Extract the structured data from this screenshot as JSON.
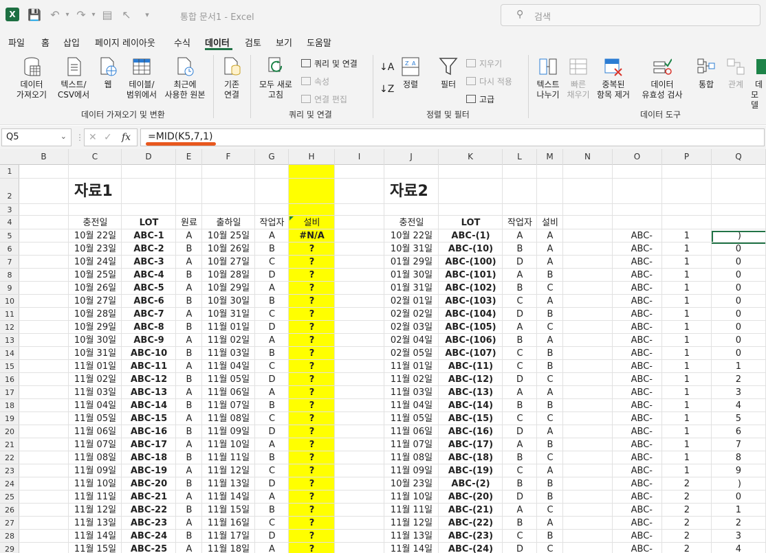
{
  "title_bar": {
    "doc_title": "통합 문서1  -  Excel",
    "search_placeholder": "검색"
  },
  "tabs": [
    "파일",
    "홈",
    "삽입",
    "페이지 레이아웃",
    "수식",
    "데이터",
    "검토",
    "보기",
    "도움말"
  ],
  "active_tab": "데이터",
  "ribbon": {
    "get_data": "데이터\n가져오기",
    "text_csv": "텍스트/\nCSV에서",
    "web": "웹",
    "table_range": "테이블/\n범위에서",
    "recent_sources": "최근에\n사용한 원본",
    "existing_connections": "기존\n연결",
    "group1_label": "데이터 가져오기 및 변환",
    "refresh_all": "모두 새로\n고침",
    "queries_connections": "쿼리 및 연결",
    "properties": "속성",
    "edit_links": "연결 편집",
    "group2_label": "쿼리 및 연결",
    "sort": "정렬",
    "filter": "필터",
    "clear": "지우기",
    "reapply": "다시 적용",
    "advanced": "고급",
    "group3_label": "정렬 및 필터",
    "text_to_columns": "텍스트\n나누기",
    "flash_fill": "빠른\n채우기",
    "remove_duplicates": "중복된\n항목 제거",
    "data_validation": "데이터\n유효성 검사",
    "consolidate": "통합",
    "relationships": "관계",
    "data_model": "데\n모델",
    "group4_label": "데이터 도구"
  },
  "formula_bar": {
    "name_box": "Q5",
    "formula": "=MID(K5,7,1)",
    "fx_label": "fx"
  },
  "columns": [
    "B",
    "C",
    "D",
    "E",
    "F",
    "G",
    "H",
    "I",
    "J",
    "K",
    "L",
    "M",
    "N",
    "O",
    "P",
    "Q"
  ],
  "rows_visible": [
    "1",
    "2",
    "3",
    "4",
    "5",
    "6",
    "7",
    "8",
    "9",
    "10",
    "11",
    "12",
    "13",
    "14",
    "15",
    "16",
    "17",
    "18",
    "19",
    "20",
    "21",
    "22",
    "23",
    "24",
    "25",
    "26",
    "27",
    "28",
    "29"
  ],
  "table1": {
    "title": "자료1",
    "headers": [
      "충전일",
      "LOT",
      "원료",
      "출하일",
      "작업자",
      "설비"
    ],
    "rows": [
      [
        "10월 22일",
        "ABC-1",
        "A",
        "10월 25일",
        "A",
        "#N/A"
      ],
      [
        "10월 23일",
        "ABC-2",
        "B",
        "10월 26일",
        "B",
        "?"
      ],
      [
        "10월 24일",
        "ABC-3",
        "A",
        "10월 27일",
        "C",
        "?"
      ],
      [
        "10월 25일",
        "ABC-4",
        "B",
        "10월 28일",
        "D",
        "?"
      ],
      [
        "10월 26일",
        "ABC-5",
        "A",
        "10월 29일",
        "A",
        "?"
      ],
      [
        "10월 27일",
        "ABC-6",
        "B",
        "10월 30일",
        "B",
        "?"
      ],
      [
        "10월 28일",
        "ABC-7",
        "A",
        "10월 31일",
        "C",
        "?"
      ],
      [
        "10월 29일",
        "ABC-8",
        "B",
        "11월 01일",
        "D",
        "?"
      ],
      [
        "10월 30일",
        "ABC-9",
        "A",
        "11월 02일",
        "A",
        "?"
      ],
      [
        "10월 31일",
        "ABC-10",
        "B",
        "11월 03일",
        "B",
        "?"
      ],
      [
        "11월 01일",
        "ABC-11",
        "A",
        "11월 04일",
        "C",
        "?"
      ],
      [
        "11월 02일",
        "ABC-12",
        "B",
        "11월 05일",
        "D",
        "?"
      ],
      [
        "11월 03일",
        "ABC-13",
        "A",
        "11월 06일",
        "A",
        "?"
      ],
      [
        "11월 04일",
        "ABC-14",
        "B",
        "11월 07일",
        "B",
        "?"
      ],
      [
        "11월 05일",
        "ABC-15",
        "A",
        "11월 08일",
        "C",
        "?"
      ],
      [
        "11월 06일",
        "ABC-16",
        "B",
        "11월 09일",
        "D",
        "?"
      ],
      [
        "11월 07일",
        "ABC-17",
        "A",
        "11월 10일",
        "A",
        "?"
      ],
      [
        "11월 08일",
        "ABC-18",
        "B",
        "11월 11일",
        "B",
        "?"
      ],
      [
        "11월 09일",
        "ABC-19",
        "A",
        "11월 12일",
        "C",
        "?"
      ],
      [
        "11월 10일",
        "ABC-20",
        "B",
        "11월 13일",
        "D",
        "?"
      ],
      [
        "11월 11일",
        "ABC-21",
        "A",
        "11월 14일",
        "A",
        "?"
      ],
      [
        "11월 12일",
        "ABC-22",
        "B",
        "11월 15일",
        "B",
        "?"
      ],
      [
        "11월 13일",
        "ABC-23",
        "A",
        "11월 16일",
        "C",
        "?"
      ],
      [
        "11월 14일",
        "ABC-24",
        "B",
        "11월 17일",
        "D",
        "?"
      ],
      [
        "11월 15일",
        "ABC-25",
        "A",
        "11월 18일",
        "A",
        "?"
      ]
    ]
  },
  "table2": {
    "title": "자료2",
    "headers": [
      "충전일",
      "LOT",
      "작업자",
      "설비"
    ],
    "rows": [
      [
        "10월 22일",
        "ABC-(1)",
        "A",
        "A",
        "ABC-",
        "1",
        ")"
      ],
      [
        "10월 31일",
        "ABC-(10)",
        "B",
        "A",
        "ABC-",
        "1",
        "0"
      ],
      [
        "01월 29일",
        "ABC-(100)",
        "D",
        "A",
        "ABC-",
        "1",
        "0"
      ],
      [
        "01월 30일",
        "ABC-(101)",
        "A",
        "B",
        "ABC-",
        "1",
        "0"
      ],
      [
        "01월 31일",
        "ABC-(102)",
        "B",
        "C",
        "ABC-",
        "1",
        "0"
      ],
      [
        "02월 01일",
        "ABC-(103)",
        "C",
        "A",
        "ABC-",
        "1",
        "0"
      ],
      [
        "02월 02일",
        "ABC-(104)",
        "D",
        "B",
        "ABC-",
        "1",
        "0"
      ],
      [
        "02월 03일",
        "ABC-(105)",
        "A",
        "C",
        "ABC-",
        "1",
        "0"
      ],
      [
        "02월 04일",
        "ABC-(106)",
        "B",
        "A",
        "ABC-",
        "1",
        "0"
      ],
      [
        "02월 05일",
        "ABC-(107)",
        "C",
        "B",
        "ABC-",
        "1",
        "0"
      ],
      [
        "11월 01일",
        "ABC-(11)",
        "C",
        "B",
        "ABC-",
        "1",
        "1"
      ],
      [
        "11월 02일",
        "ABC-(12)",
        "D",
        "C",
        "ABC-",
        "1",
        "2"
      ],
      [
        "11월 03일",
        "ABC-(13)",
        "A",
        "A",
        "ABC-",
        "1",
        "3"
      ],
      [
        "11월 04일",
        "ABC-(14)",
        "B",
        "B",
        "ABC-",
        "1",
        "4"
      ],
      [
        "11월 05일",
        "ABC-(15)",
        "C",
        "C",
        "ABC-",
        "1",
        "5"
      ],
      [
        "11월 06일",
        "ABC-(16)",
        "D",
        "A",
        "ABC-",
        "1",
        "6"
      ],
      [
        "11월 07일",
        "ABC-(17)",
        "A",
        "B",
        "ABC-",
        "1",
        "7"
      ],
      [
        "11월 08일",
        "ABC-(18)",
        "B",
        "C",
        "ABC-",
        "1",
        "8"
      ],
      [
        "11월 09일",
        "ABC-(19)",
        "C",
        "A",
        "ABC-",
        "1",
        "9"
      ],
      [
        "10월 23일",
        "ABC-(2)",
        "B",
        "B",
        "ABC-",
        "2",
        ")"
      ],
      [
        "11월 10일",
        "ABC-(20)",
        "D",
        "B",
        "ABC-",
        "2",
        "0"
      ],
      [
        "11월 11일",
        "ABC-(21)",
        "A",
        "C",
        "ABC-",
        "2",
        "1"
      ],
      [
        "11월 12일",
        "ABC-(22)",
        "B",
        "A",
        "ABC-",
        "2",
        "2"
      ],
      [
        "11월 13일",
        "ABC-(23)",
        "C",
        "B",
        "ABC-",
        "2",
        "3"
      ],
      [
        "11월 14일",
        "ABC-(24)",
        "D",
        "C",
        "ABC-",
        "2",
        "4"
      ]
    ]
  },
  "colors": {
    "accent": "#217346",
    "highlight_column": "#ffff00",
    "formula_underline": "#e8581e"
  }
}
